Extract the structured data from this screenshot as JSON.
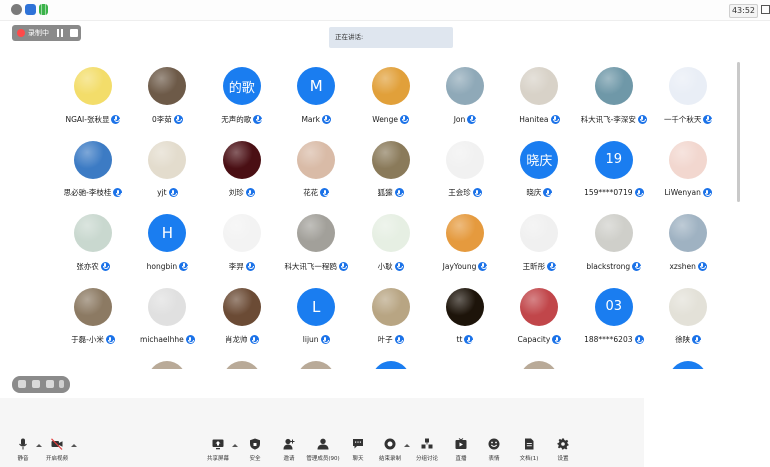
{
  "timer": "43:52",
  "recording": {
    "label": "录制中"
  },
  "speaking": {
    "label": "正在讲话:"
  },
  "participants": [
    {
      "name": "NGAI-张秋显",
      "avatar": "photo",
      "color": "#f3dd6a",
      "muted": false
    },
    {
      "name": "0李茹",
      "avatar": "photo",
      "color": "#6d5a48",
      "muted": false
    },
    {
      "name": "无声的歌",
      "avatar": "letter",
      "initials": "的歌",
      "muted": false
    },
    {
      "name": "Mark",
      "avatar": "letter",
      "initials": "M",
      "muted": true
    },
    {
      "name": "Wenge",
      "avatar": "photo",
      "color": "#e1a03a",
      "muted": false
    },
    {
      "name": "Jon",
      "avatar": "photo",
      "color": "#8fa9b8",
      "muted": false
    },
    {
      "name": "Hanitea",
      "avatar": "photo",
      "color": "#d8d2c8",
      "muted": false
    },
    {
      "name": "科大讯飞-李深安",
      "avatar": "photo",
      "color": "#6f98a8",
      "muted": false
    },
    {
      "name": "一千个秋天",
      "avatar": "photo",
      "color": "#e9eef6",
      "muted": false
    },
    {
      "name": "思必驰-李枝桂",
      "avatar": "photo",
      "color": "#3c7bc4",
      "muted": false
    },
    {
      "name": "yjt",
      "avatar": "photo",
      "color": "#e3dccd",
      "muted": true
    },
    {
      "name": "刘珍",
      "avatar": "photo",
      "color": "#4a0f14",
      "muted": false
    },
    {
      "name": "花花",
      "avatar": "photo",
      "color": "#d9bba7",
      "muted": true
    },
    {
      "name": "狐獴",
      "avatar": "photo",
      "color": "#8a7a5a",
      "muted": false
    },
    {
      "name": "王会珍",
      "avatar": "photo",
      "color": "#f1f1f1",
      "muted": false
    },
    {
      "name": "晓庆",
      "avatar": "letter",
      "initials": "晓庆",
      "muted": false
    },
    {
      "name": "159****0719",
      "avatar": "letter",
      "initials": "19",
      "muted": false
    },
    {
      "name": "LiWenyan",
      "avatar": "photo",
      "color": "#f2d7cf",
      "muted": false
    },
    {
      "name": "张亦农",
      "avatar": "photo",
      "color": "#c9d8cf",
      "muted": false
    },
    {
      "name": "hongbin",
      "avatar": "letter",
      "initials": "H",
      "muted": false
    },
    {
      "name": "李羿",
      "avatar": "photo",
      "color": "#f3f3f3",
      "muted": false
    },
    {
      "name": "科大讯飞一程鸥",
      "avatar": "photo",
      "color": "#a2a09a",
      "muted": false
    },
    {
      "name": "小耿",
      "avatar": "photo",
      "color": "#e6efe3",
      "muted": false
    },
    {
      "name": "JayYoung",
      "avatar": "photo",
      "color": "#e59a3e",
      "muted": false
    },
    {
      "name": "王昕彤",
      "avatar": "photo",
      "color": "#f0f0f0",
      "muted": false
    },
    {
      "name": "blackstrong",
      "avatar": "photo",
      "color": "#cfcfca",
      "muted": false
    },
    {
      "name": "xzshen",
      "avatar": "photo",
      "color": "#9fb2c2",
      "muted": false
    },
    {
      "name": "于磊-小米",
      "avatar": "photo",
      "color": "#8c7a63",
      "muted": false
    },
    {
      "name": "michaelhhe",
      "avatar": "photo",
      "color": "#e0e0e0",
      "muted": false
    },
    {
      "name": "肖龙帅",
      "avatar": "photo",
      "color": "#6b4b35",
      "muted": false
    },
    {
      "name": "lijun",
      "avatar": "letter",
      "initials": "L",
      "muted": false
    },
    {
      "name": "叶子",
      "avatar": "photo",
      "color": "#b8a583",
      "muted": false
    },
    {
      "name": "tt",
      "avatar": "photo",
      "color": "#1d140a",
      "muted": true
    },
    {
      "name": "Capacity",
      "avatar": "photo",
      "color": "#c1464a",
      "muted": false
    },
    {
      "name": "188****6203",
      "avatar": "letter",
      "initials": "03",
      "muted": false
    },
    {
      "name": "徐陕",
      "avatar": "photo",
      "color": "#e3e1d8",
      "muted": false
    }
  ],
  "toolbar": {
    "mute": "静音",
    "video": "开启视频",
    "share": "共享屏幕",
    "security": "安全",
    "invite": "邀请",
    "members": "管理成员(90)",
    "chat": "聊天",
    "record": "结束录制",
    "breakout": "分组讨论",
    "live": "直播",
    "reactions": "表情",
    "docs": "文档(1)",
    "settings": "设置"
  }
}
